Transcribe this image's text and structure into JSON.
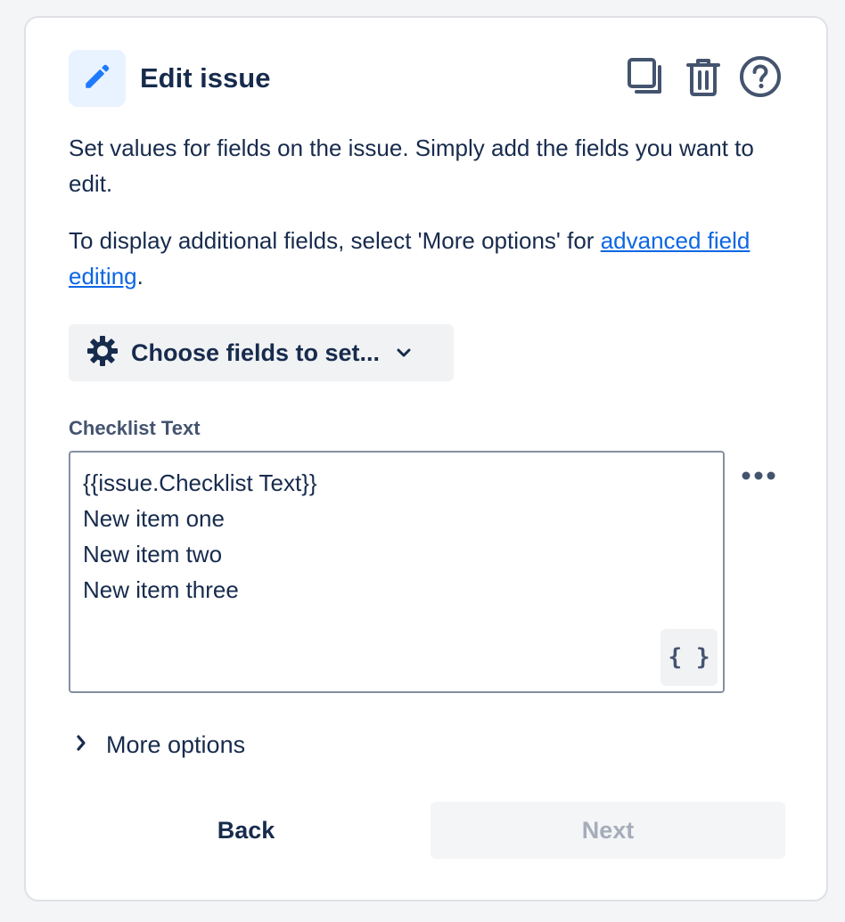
{
  "header": {
    "title": "Edit issue",
    "icon": "pencil-icon",
    "actions": [
      "duplicate-icon",
      "trash-icon",
      "help-icon"
    ]
  },
  "description": {
    "line1": "Set values for fields on the issue. Simply add the fields you want to edit.",
    "line2_prefix": "To display additional fields, select 'More options' for ",
    "line2_link": "advanced field editing",
    "line2_suffix": "."
  },
  "choose_fields": {
    "label": "Choose fields to set...",
    "icon": "gear-icon"
  },
  "field": {
    "label": "Checklist Text",
    "lines": [
      "{{issue.Checklist Text}}",
      "New item one",
      "New item two",
      "New item three"
    ],
    "smart_value_label": "{ }"
  },
  "more_options": {
    "label": "More options"
  },
  "footer": {
    "back_label": "Back",
    "next_label": "Next"
  },
  "colors": {
    "text": "#172b4d",
    "link": "#0c66e4",
    "accent_icon_bg": "#e9f2ff",
    "accent_icon": "#1d7afc",
    "disabled_text": "#a5adba"
  }
}
